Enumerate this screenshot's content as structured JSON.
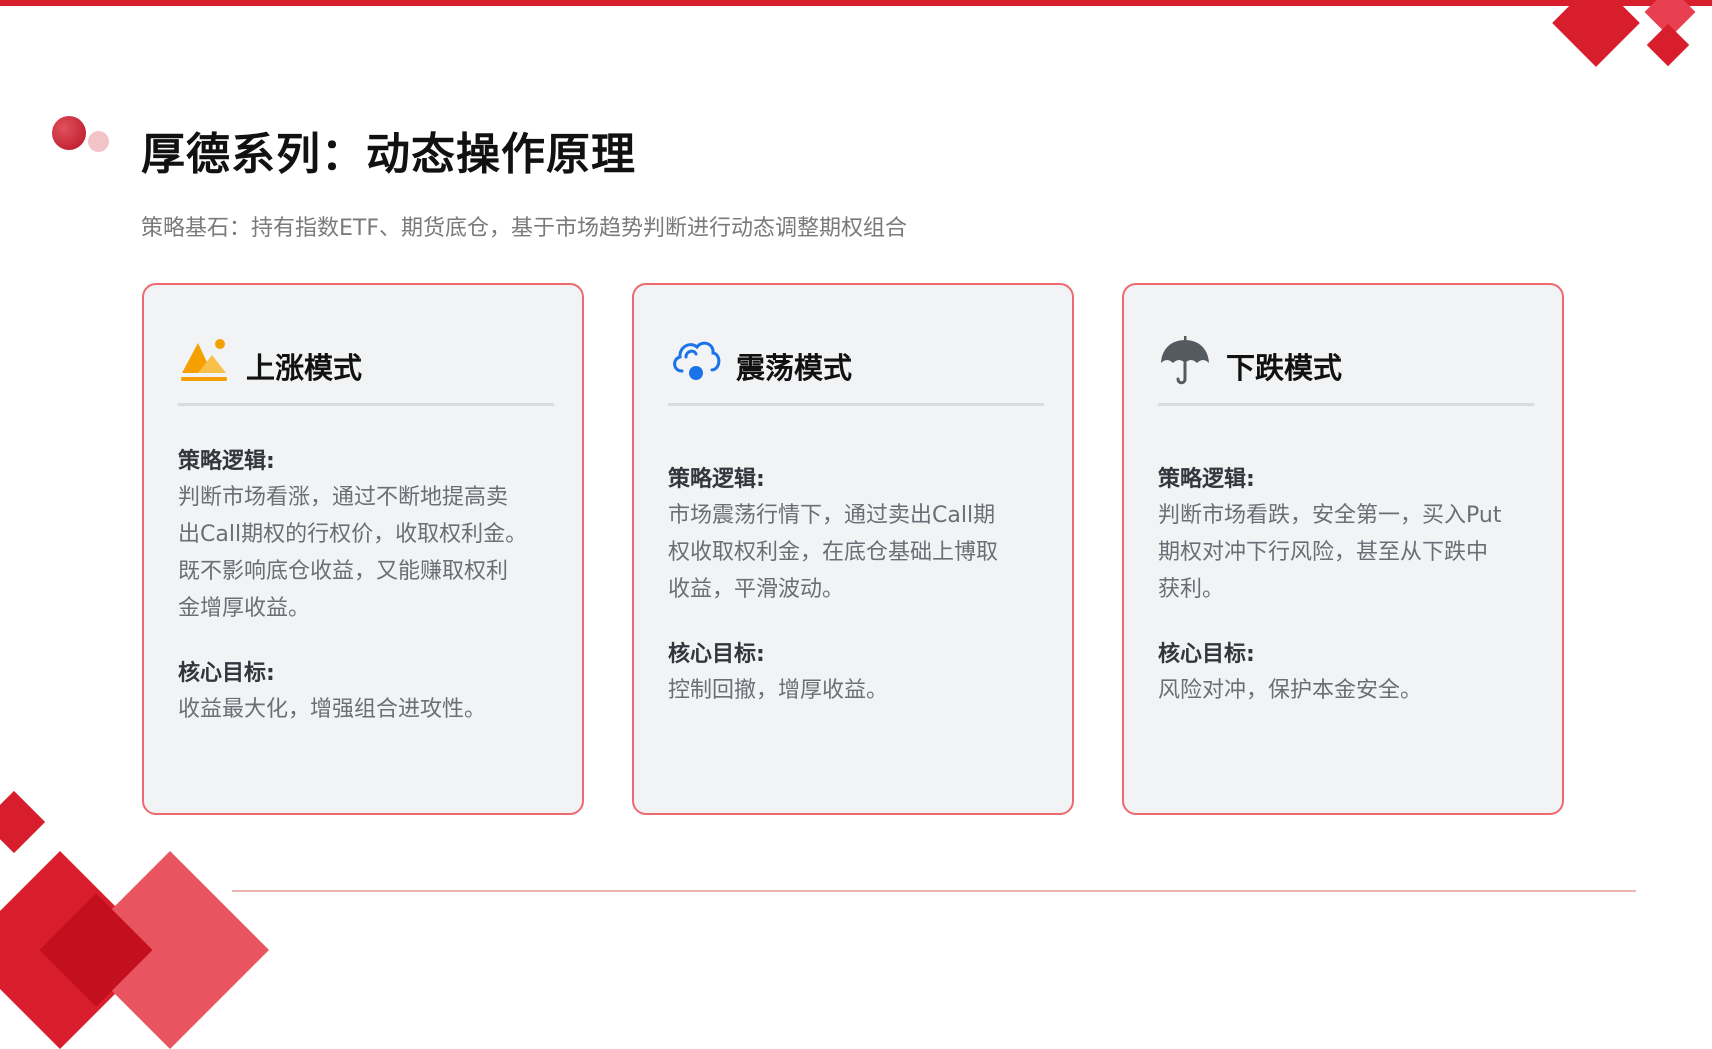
{
  "header": {
    "title": "厚德系列：动态操作原理",
    "subtitle": "策略基石：持有指数ETF、期货底仓，基于市场趋势判断进行动态调整期权组合"
  },
  "colors": {
    "accent_red": "#d81e2c",
    "card_border": "#ee6a70",
    "card_bg": "#f2f3f5",
    "icon_bull": "#f5a000",
    "icon_range": "#1a73e8",
    "icon_bear": "#555a60"
  },
  "cards": [
    {
      "icon": "mountain-sun-icon",
      "title": "上涨模式",
      "logic_label": "策略逻辑:",
      "logic_text": "判断市场看涨，通过不断地提高卖\n出Call期权的行权价，收取权利金。\n既不影响底仓收益，又能赚取权利\n金增厚收益。",
      "goal_label": "核心目标:",
      "goal_text": "收益最大化，增强组合进攻性。"
    },
    {
      "icon": "cloud-icon",
      "title": "震荡模式",
      "logic_label": "策略逻辑:",
      "logic_text": "市场震荡行情下，通过卖出Call期\n权收取权利金，在底仓基础上博取\n收益，平滑波动。",
      "goal_label": "核心目标:",
      "goal_text": "控制回撤，增厚收益。"
    },
    {
      "icon": "umbrella-icon",
      "title": "下跌模式",
      "logic_label": "策略逻辑:",
      "logic_text": "判断市场看跌，安全第一，买入Put\n期权对冲下行风险，甚至从下跌中\n获利。",
      "goal_label": "核心目标:",
      "goal_text": "风险对冲，保护本金安全。"
    }
  ]
}
